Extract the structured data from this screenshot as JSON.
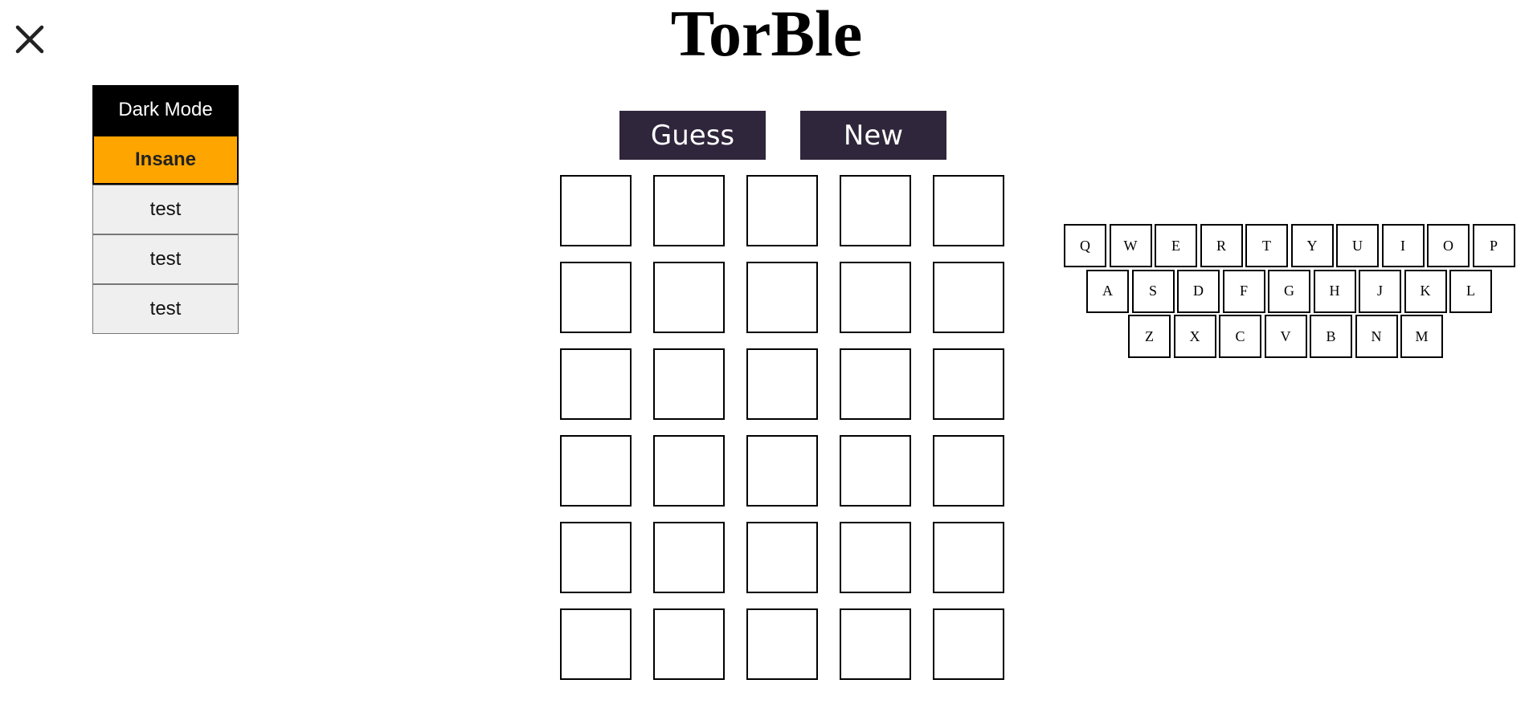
{
  "app": {
    "title": "TorBle"
  },
  "menu": {
    "items": [
      {
        "label": "Dark Mode",
        "style": "dark"
      },
      {
        "label": "Insane",
        "style": "insane"
      },
      {
        "label": "test",
        "style": "plain"
      },
      {
        "label": "test",
        "style": "plain"
      },
      {
        "label": "test",
        "style": "plain"
      }
    ]
  },
  "actions": {
    "guess_label": "Guess",
    "new_label": "New"
  },
  "board": {
    "rows": 6,
    "cols": 5,
    "cells": [
      [
        "",
        "",
        "",
        "",
        ""
      ],
      [
        "",
        "",
        "",
        "",
        ""
      ],
      [
        "",
        "",
        "",
        "",
        ""
      ],
      [
        "",
        "",
        "",
        "",
        ""
      ],
      [
        "",
        "",
        "",
        "",
        ""
      ],
      [
        "",
        "",
        "",
        "",
        ""
      ]
    ]
  },
  "keyboard": {
    "rows": [
      [
        "Q",
        "W",
        "E",
        "R",
        "T",
        "Y",
        "U",
        "I",
        "O",
        "P"
      ],
      [
        "A",
        "S",
        "D",
        "F",
        "G",
        "H",
        "J",
        "K",
        "L"
      ],
      [
        "Z",
        "X",
        "C",
        "V",
        "B",
        "N",
        "M"
      ]
    ]
  },
  "icons": {
    "close": "close-icon"
  },
  "colors": {
    "action_button_bg": "#30263b",
    "insane_bg": "#ffa500",
    "dark_mode_bg": "#000000"
  }
}
